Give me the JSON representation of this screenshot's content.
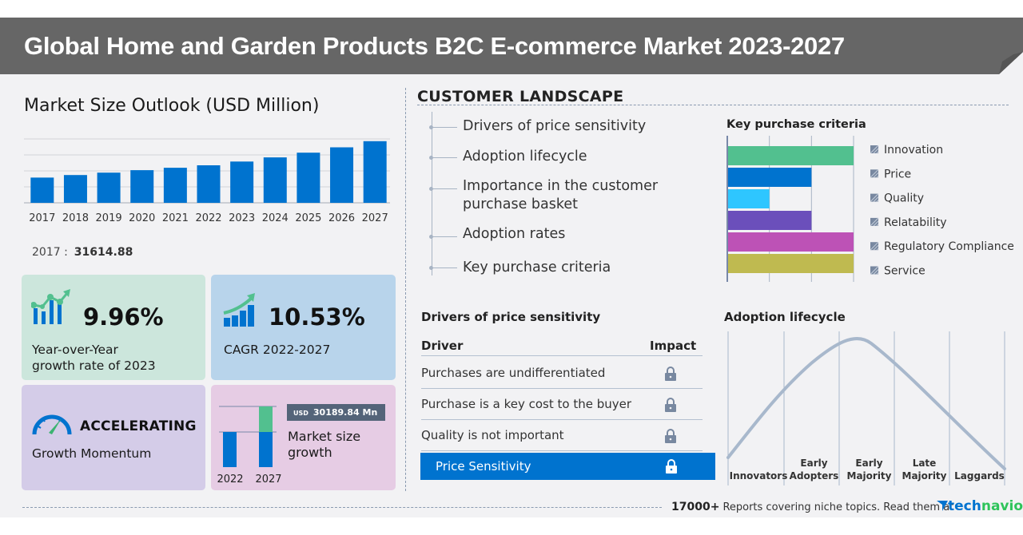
{
  "header": {
    "title": "Global Home and Garden Products B2C E-commerce Market 2023-2027"
  },
  "market_outlook": {
    "title": "Market Size Outlook (USD Million)",
    "base_year_label": "2017 :",
    "base_year_value": "31614.88"
  },
  "chart_data": [
    {
      "type": "bar",
      "title": "Market Size Outlook (USD Million)",
      "categories": [
        "2017",
        "2018",
        "2019",
        "2020",
        "2021",
        "2022",
        "2023",
        "2024",
        "2025",
        "2026",
        "2027"
      ],
      "values": [
        31614.88,
        34800,
        37800,
        40900,
        43900,
        47000,
        51700,
        56900,
        62800,
        69500,
        77200
      ],
      "ylim": [
        0,
        80000
      ],
      "grid": true,
      "color": "#0073cf",
      "xlabel": "",
      "ylabel": ""
    },
    {
      "type": "bar",
      "orientation": "horizontal",
      "title": "Key purchase criteria",
      "categories": [
        "Innovation",
        "Price",
        "Quality",
        "Relatability",
        "Regulatory Compliance",
        "Service"
      ],
      "values": [
        3,
        2,
        1,
        2,
        3,
        3
      ],
      "xlim": [
        0,
        3
      ],
      "colors": [
        "#52c08f",
        "#0073cf",
        "#2ec6ff",
        "#6b4fbb",
        "#bd52b6",
        "#bfba50"
      ],
      "legend": "right"
    },
    {
      "type": "line",
      "title": "Adoption lifecycle",
      "categories": [
        "Innovators",
        "Early Adopters",
        "Early Majority",
        "Late Majority",
        "Laggards"
      ],
      "shape": "bell-curve",
      "color": "#a8b8cc"
    }
  ],
  "cards": {
    "yoy": {
      "value": "9.96%",
      "label_line1": "Year-over-Year",
      "label_line2": "growth rate of 2023"
    },
    "cagr": {
      "value": "10.53%",
      "label": "CAGR 2022-2027"
    },
    "momentum": {
      "value": "ACCELERATING",
      "label": "Growth Momentum"
    },
    "growth": {
      "currency": "USD",
      "amount": "30189.84 Mn",
      "label_line1": "Market size",
      "label_line2": "growth",
      "year_start": "2022",
      "year_end": "2027",
      "colors": {
        "base": "#0073cf",
        "increment": "#52c08f"
      }
    }
  },
  "customer_landscape": {
    "title": "CUSTOMER LANDSCAPE",
    "items": [
      {
        "line1": "Drivers of price sensitivity"
      },
      {
        "line1": "Adoption lifecycle"
      },
      {
        "line1": "Importance in the customer",
        "line2": "purchase basket"
      },
      {
        "line1": "Adoption rates"
      },
      {
        "line1": "Key purchase criteria"
      }
    ]
  },
  "key_purchase_criteria": {
    "title": "Key purchase criteria"
  },
  "drivers": {
    "title": "Drivers of price sensitivity",
    "col_driver": "Driver",
    "col_impact": "Impact",
    "rows": [
      {
        "label": "Purchases are undifferentiated",
        "icon": "lock-icon"
      },
      {
        "label": "Purchase is a key cost to the buyer",
        "icon": "lock-icon"
      },
      {
        "label": "Quality is not important",
        "icon": "lock-icon"
      }
    ],
    "highlight": {
      "label": "Price Sensitivity",
      "icon": "lock-icon"
    }
  },
  "adoption": {
    "title": "Adoption lifecycle",
    "stages": [
      {
        "line1": "",
        "line2": "Innovators"
      },
      {
        "line1": "Early",
        "line2": "Adopters"
      },
      {
        "line1": "Early",
        "line2": "Majority"
      },
      {
        "line1": "Late",
        "line2": "Majority"
      },
      {
        "line1": "",
        "line2": "Laggards"
      }
    ]
  },
  "footer": {
    "count": "17000+",
    "text": "Reports covering niche topics. Read them at",
    "brand_part1": "tech",
    "brand_part2": "navio"
  }
}
